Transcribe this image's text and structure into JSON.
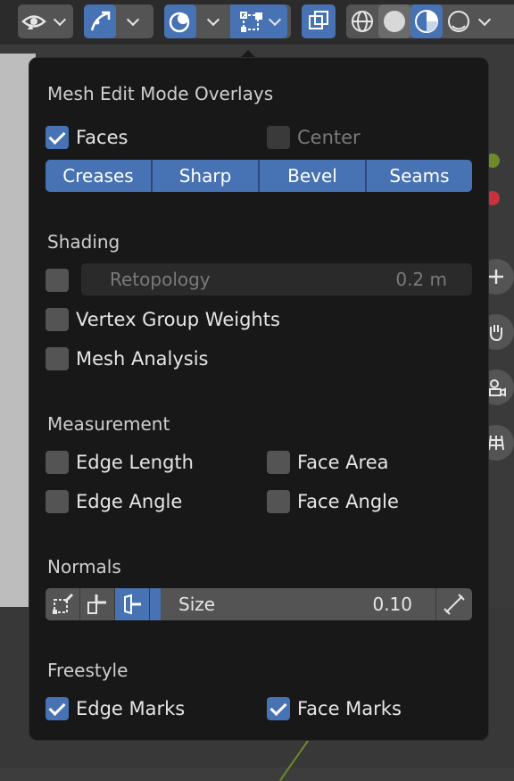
{
  "toolbar": {
    "groups": [
      {
        "name": "visibility",
        "icons": [
          "eye-icon",
          "cursor-select-icon"
        ]
      },
      {
        "name": "gizmos",
        "icons": [
          "gizmo-arrow-icon"
        ]
      },
      {
        "name": "overlays",
        "icons": [
          "overlay-circles-icon",
          "mesh-edit-overlay-icon"
        ]
      },
      {
        "name": "xray",
        "icons": [
          "xray-toggle-icon"
        ]
      },
      {
        "name": "shading",
        "icons": [
          "wireframe-shading-icon",
          "solid-shading-icon",
          "material-shading-icon",
          "rendered-shading-icon"
        ]
      }
    ],
    "active_color": "#4772b3"
  },
  "panel": {
    "title": "Mesh Edit Mode Overlays",
    "faces": {
      "label": "Faces",
      "checked": true
    },
    "center": {
      "label": "Center",
      "checked": false
    },
    "edge_buttons": [
      "Creases",
      "Sharp",
      "Bevel",
      "Seams"
    ],
    "shading": {
      "title": "Shading",
      "retopology": {
        "label": "Retopology",
        "value": "0.2 m",
        "checked": false
      },
      "vertex_group_weights": {
        "label": "Vertex Group Weights",
        "checked": false
      },
      "mesh_analysis": {
        "label": "Mesh Analysis",
        "checked": false
      }
    },
    "measurement": {
      "title": "Measurement",
      "edge_length": {
        "label": "Edge Length",
        "checked": false
      },
      "face_area": {
        "label": "Face Area",
        "checked": false
      },
      "edge_angle": {
        "label": "Edge Angle",
        "checked": false
      },
      "face_angle": {
        "label": "Face Angle",
        "checked": false
      }
    },
    "normals": {
      "title": "Normals",
      "size_label": "Size",
      "size_value": "0.10"
    },
    "freestyle": {
      "title": "Freestyle",
      "edge_marks": {
        "label": "Edge Marks",
        "checked": true
      },
      "face_marks": {
        "label": "Face Marks",
        "checked": true
      }
    }
  }
}
